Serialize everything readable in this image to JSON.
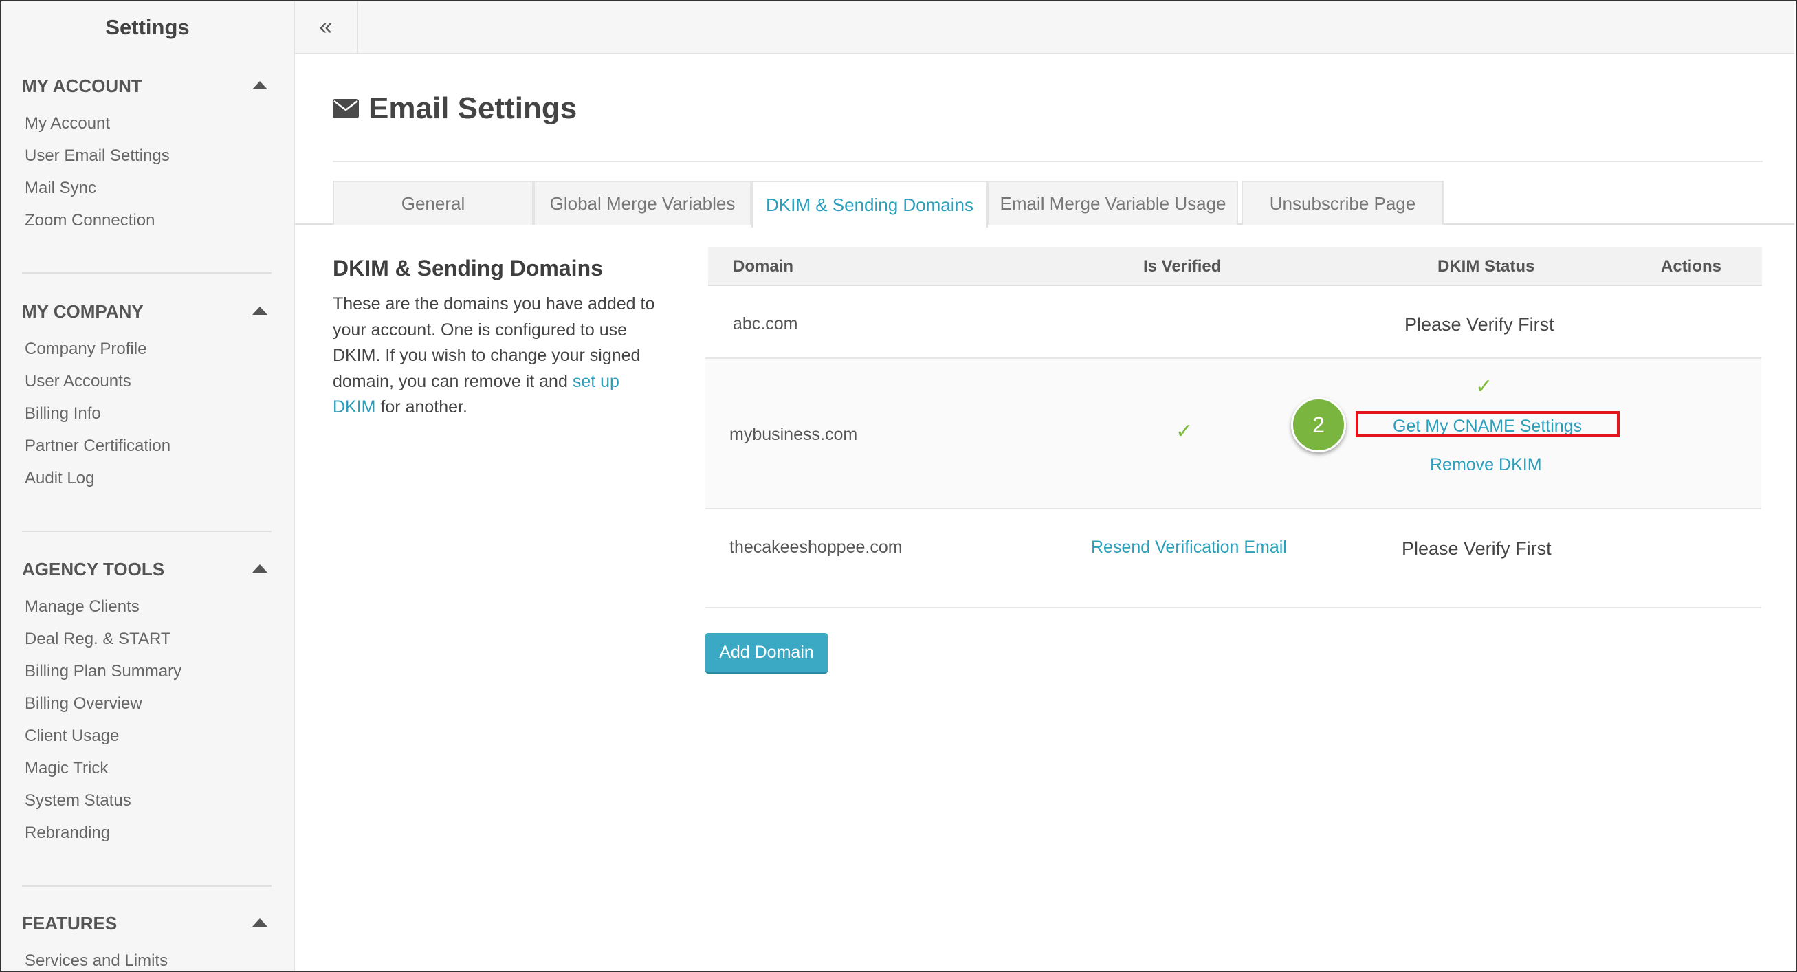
{
  "sidebar": {
    "title": "Settings",
    "sections": [
      {
        "title": "MY ACCOUNT",
        "items": [
          "My Account",
          "User Email Settings",
          "Mail Sync",
          "Zoom Connection"
        ]
      },
      {
        "title": "MY COMPANY",
        "items": [
          "Company Profile",
          "User Accounts",
          "Billing Info",
          "Partner Certification",
          "Audit Log"
        ]
      },
      {
        "title": "AGENCY TOOLS",
        "items": [
          "Manage Clients",
          "Deal Reg. & START",
          "Billing Plan Summary",
          "Billing Overview",
          "Client Usage",
          "Magic Trick",
          "System Status",
          "Rebranding"
        ]
      },
      {
        "title": "FEATURES",
        "items": [
          "Services and Limits"
        ]
      }
    ]
  },
  "topbar": {
    "collapse_glyph": "«"
  },
  "page": {
    "title": "Email Settings",
    "icon": "envelope-icon"
  },
  "tabs": [
    {
      "label": "General",
      "active": false
    },
    {
      "label": "Global Merge Variables",
      "active": false
    },
    {
      "label": "DKIM & Sending Domains",
      "active": true
    },
    {
      "label": "Email Merge Variable Usage",
      "active": false
    },
    {
      "label": "Unsubscribe Page",
      "active": false
    }
  ],
  "description": {
    "title": "DKIM & Sending Domains",
    "text_before": "These are the domains you have added to your account. One is configured to use DKIM. If you wish to change your signed domain, you can remove it and ",
    "link": "set up DKIM",
    "text_after": " for another."
  },
  "table": {
    "headers": {
      "domain": "Domain",
      "verified": "Is Verified",
      "dkim": "DKIM Status",
      "actions": "Actions"
    },
    "rows": [
      {
        "domain": "abc.com",
        "verified": "",
        "dkim_status": "Please Verify First"
      },
      {
        "domain": "mybusiness.com",
        "verified": "✓",
        "dkim_check": "✓",
        "dkim_link": "Get My CNAME Settings",
        "dkim_remove": "Remove DKIM"
      },
      {
        "domain": "thecakeeshoppee.com",
        "verified_link": "Resend Verification Email",
        "dkim_status": "Please Verify First"
      }
    ]
  },
  "annotation": {
    "step": "2",
    "highlight_color": "#e3141b",
    "badge_color": "#79b53f"
  },
  "buttons": {
    "add_domain": "Add Domain"
  },
  "colors": {
    "accent": "#2a9fbc",
    "check": "#7dbb3b",
    "button": "#3ba9c3"
  }
}
